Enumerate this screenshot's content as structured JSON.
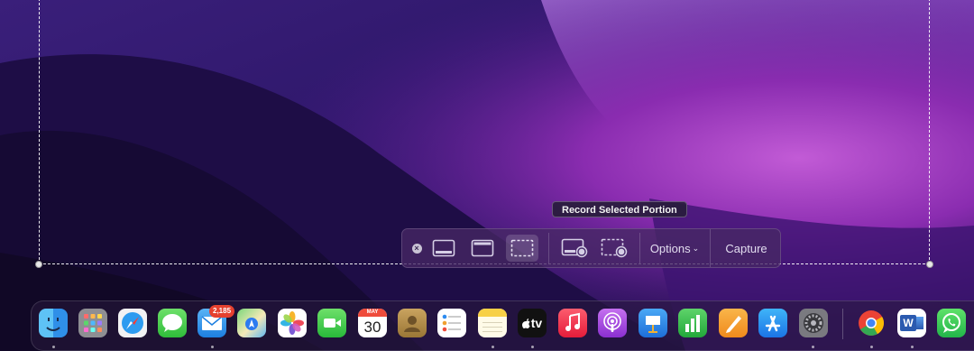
{
  "tooltip": {
    "text": "Record Selected Portion"
  },
  "toolbar": {
    "close_glyph": "×",
    "options_label": "Options",
    "options_chevron": "⌄",
    "capture_label": "Capture",
    "buttons": [
      {
        "icon": "capture-entire-screen-icon"
      },
      {
        "icon": "capture-selected-window-icon"
      },
      {
        "icon": "capture-selected-portion-icon",
        "selected": true
      },
      {
        "icon": "record-entire-screen-icon"
      },
      {
        "icon": "record-selected-portion-icon"
      }
    ]
  },
  "dock": {
    "mail_badge": "2,185",
    "calendar_month": "MAY",
    "calendar_day": "30",
    "tv_label": "tv",
    "word_letter": "W",
    "apps": [
      {
        "name": "Finder",
        "icon": "finder-icon",
        "running": true
      },
      {
        "name": "Launchpad",
        "icon": "launchpad-icon",
        "running": false
      },
      {
        "name": "Safari",
        "icon": "safari-icon",
        "running": false
      },
      {
        "name": "Messages",
        "icon": "messages-icon",
        "running": false
      },
      {
        "name": "Mail",
        "icon": "mail-icon",
        "running": true
      },
      {
        "name": "Maps",
        "icon": "maps-icon",
        "running": false
      },
      {
        "name": "Photos",
        "icon": "photos-icon",
        "running": false
      },
      {
        "name": "FaceTime",
        "icon": "facetime-icon",
        "running": false
      },
      {
        "name": "Calendar",
        "icon": "calendar-icon",
        "running": false
      },
      {
        "name": "Contacts",
        "icon": "contacts-icon",
        "running": false
      },
      {
        "name": "Reminders",
        "icon": "reminders-icon",
        "running": false
      },
      {
        "name": "Notes",
        "icon": "notes-icon",
        "running": true
      },
      {
        "name": "TV",
        "icon": "apple-tv-icon",
        "running": true
      },
      {
        "name": "Music",
        "icon": "music-icon",
        "running": false
      },
      {
        "name": "Podcasts",
        "icon": "podcasts-icon",
        "running": false
      },
      {
        "name": "Keynote",
        "icon": "keynote-icon",
        "running": false
      },
      {
        "name": "Numbers",
        "icon": "numbers-icon",
        "running": false
      },
      {
        "name": "Pages",
        "icon": "pages-icon",
        "running": false
      },
      {
        "name": "App Store",
        "icon": "app-store-icon",
        "running": false
      },
      {
        "name": "System Preferences",
        "icon": "system-preferences-icon",
        "running": true
      },
      {
        "name": "Chrome",
        "icon": "chrome-icon",
        "running": true
      },
      {
        "name": "Word",
        "icon": "word-icon",
        "running": true
      },
      {
        "name": "WhatsApp",
        "icon": "whatsapp-icon",
        "running": false
      }
    ]
  },
  "colors": {
    "wallpaper_dark": "#150a2c",
    "wallpaper_purple": "#6a1f9a",
    "wallpaper_pink": "#b24fc8",
    "mail_badge": "#e5412f"
  }
}
